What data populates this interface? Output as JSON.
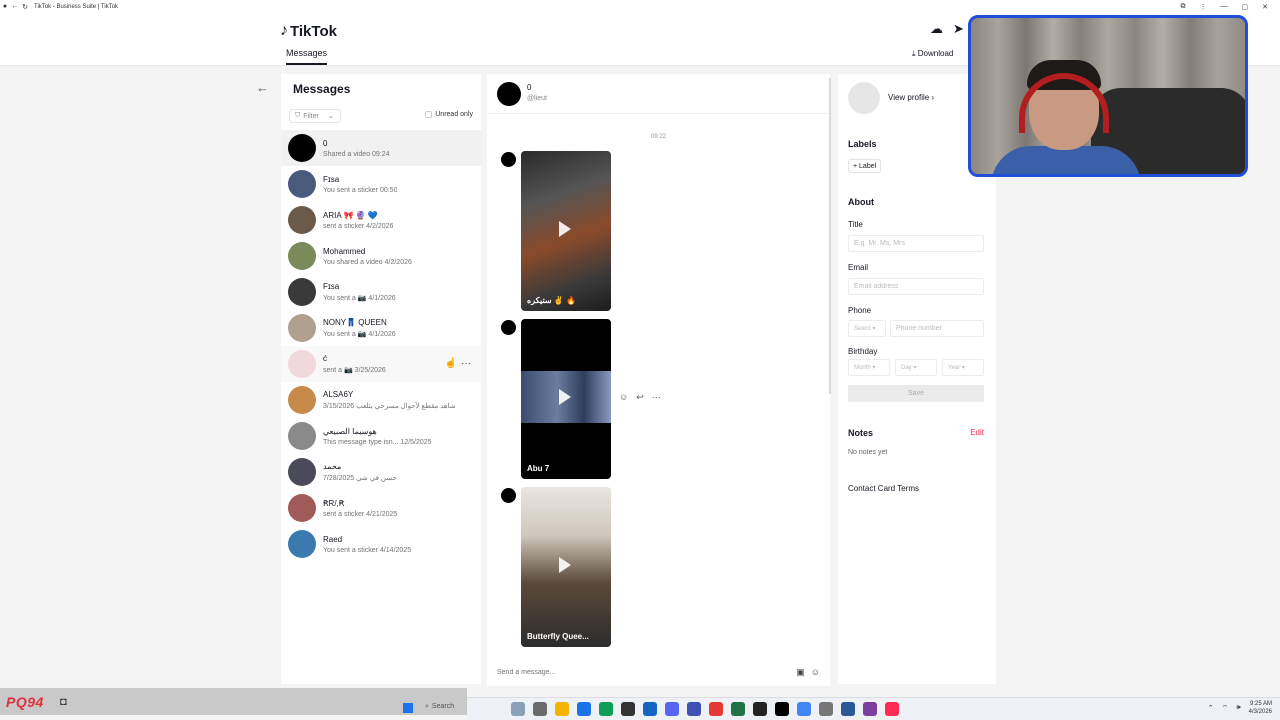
{
  "browser": {
    "tab_title": "TikTok - Business Suite | TikTok"
  },
  "header": {
    "logo": "TikTok",
    "nav_messages": "Messages",
    "download": "Download"
  },
  "list": {
    "title": "Messages",
    "filter_label": "Filter",
    "unread_only": "Unread only",
    "conversations": [
      {
        "name": "0",
        "preview": "Shared a video 09:24",
        "avatar_color": "#000000"
      },
      {
        "name": "Fɪsa",
        "preview": "You sent a sticker 00:50",
        "avatar_color": "#4a5a7a"
      },
      {
        "name": "ARIA 🎀 🔮 💙",
        "preview": "sent a sticker 4/2/2026",
        "avatar_color": "#6b5a4a"
      },
      {
        "name": "Mohammed",
        "preview": "You shared a video 4/2/2026",
        "avatar_color": "#7a8a5a"
      },
      {
        "name": "Fɪsa",
        "preview": "You sent a 📷 4/1/2026",
        "avatar_color": "#3a3a3a"
      },
      {
        "name": "NONY👖 QUEEN",
        "preview": "You sent a 📷 4/1/2026",
        "avatar_color": "#b0a090"
      },
      {
        "name": "ć",
        "preview": "sent a 📷 3/25/2026",
        "avatar_color": "#f0d8dc"
      },
      {
        "name": "ALSA6Y",
        "preview": "شاهد مقطع لأحوال مسرحي بتلعب 3/15/2026",
        "avatar_color": "#c88a4a"
      },
      {
        "name": "هوسيما الصبيعي",
        "preview": "This message type isn... 12/5/2025",
        "avatar_color": "#8a8a8a"
      },
      {
        "name": "محمد",
        "preview": "حسن في شي 7/28/2025",
        "avatar_color": "#4a4a5a"
      },
      {
        "name": "ꞦR/,Ꞧ",
        "preview": "sent a sticker 4/21/2025",
        "avatar_color": "#a05a5a"
      },
      {
        "name": "Raed",
        "preview": "You sent a sticker 4/14/2025",
        "avatar_color": "#3a7ab0"
      }
    ]
  },
  "chat": {
    "name": "0",
    "handle": "@lieut",
    "time_marker": "09:22",
    "videos": [
      {
        "caption": "ستيكره ✌️ 🔥"
      },
      {
        "caption": "Abu 7"
      },
      {
        "caption": "Butterfly Quee..."
      }
    ],
    "composer_placeholder": "Send a message..."
  },
  "contact": {
    "view_profile": "View profile ›",
    "labels_title": "Labels",
    "add_label": "+ Label",
    "about_title": "About",
    "title_label": "Title",
    "title_placeholder": "E.g. Mr, Ms, Mrs",
    "email_label": "Email",
    "email_placeholder": "Email address",
    "phone_label": "Phone",
    "phone_select": "Select ▾",
    "phone_placeholder": "Phone number",
    "birthday_label": "Birthday",
    "month": "Month ▾",
    "day": "Day ▾",
    "year": "Year ▾",
    "save": "Save",
    "notes_title": "Notes",
    "edit": "Edit",
    "no_notes": "No notes yet",
    "terms": "Contact Card Terms"
  },
  "overlay": {
    "tag": "PQ94"
  },
  "taskbar": {
    "search": "Search",
    "time": "9:25 AM",
    "date": "4/3/2026"
  }
}
